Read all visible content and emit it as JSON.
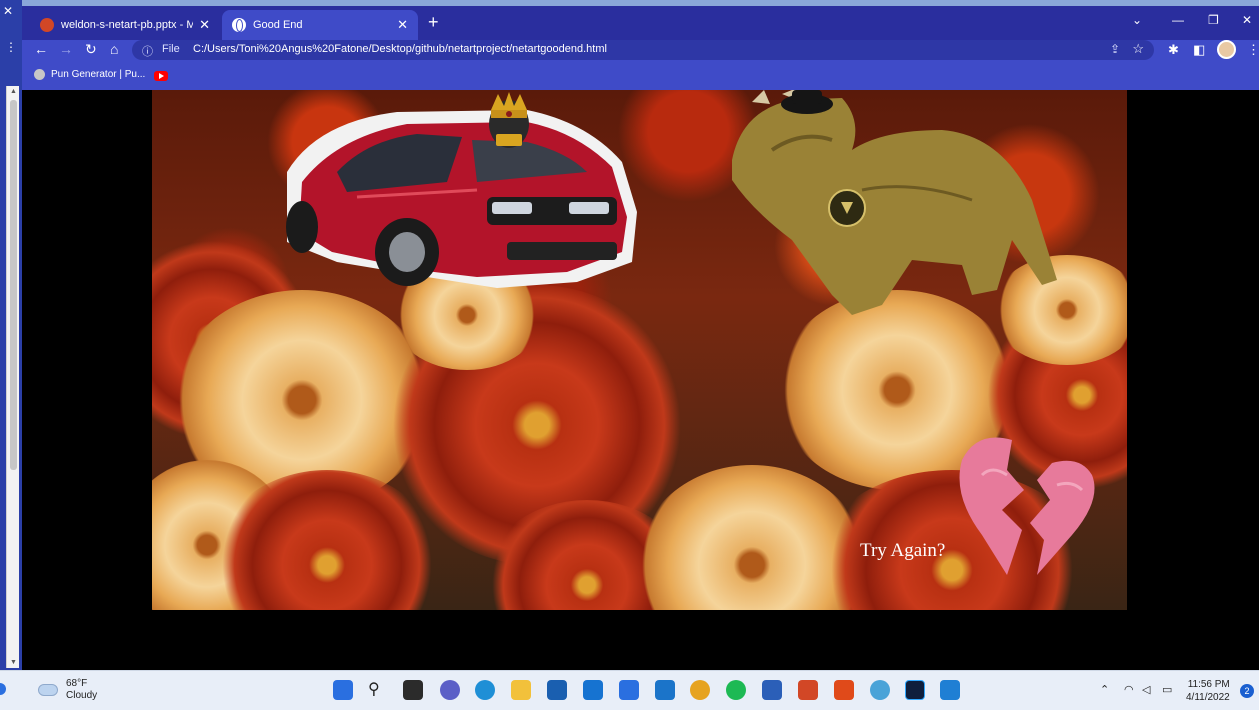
{
  "browser": {
    "tabs": [
      {
        "title": "weldon-s-netart-pb.pptx - Micro",
        "active": false,
        "icon": "powerpoint-icon"
      },
      {
        "title": "Good End",
        "active": true,
        "icon": "globe-icon"
      }
    ],
    "address": {
      "label": "File",
      "url": "C:/Users/Toni%20Angus%20Fatone/Desktop/github/netartproject/netartgoodend.html"
    },
    "bookmarks": [
      {
        "label": "Pun Generator | Pu..."
      }
    ]
  },
  "page": {
    "link_text": "Try Again?"
  },
  "taskbar": {
    "weather": {
      "temp": "68°F",
      "condition": "Cloudy"
    },
    "clock": {
      "time": "11:56 PM",
      "date": "4/11/2022"
    },
    "notifications": "2"
  }
}
